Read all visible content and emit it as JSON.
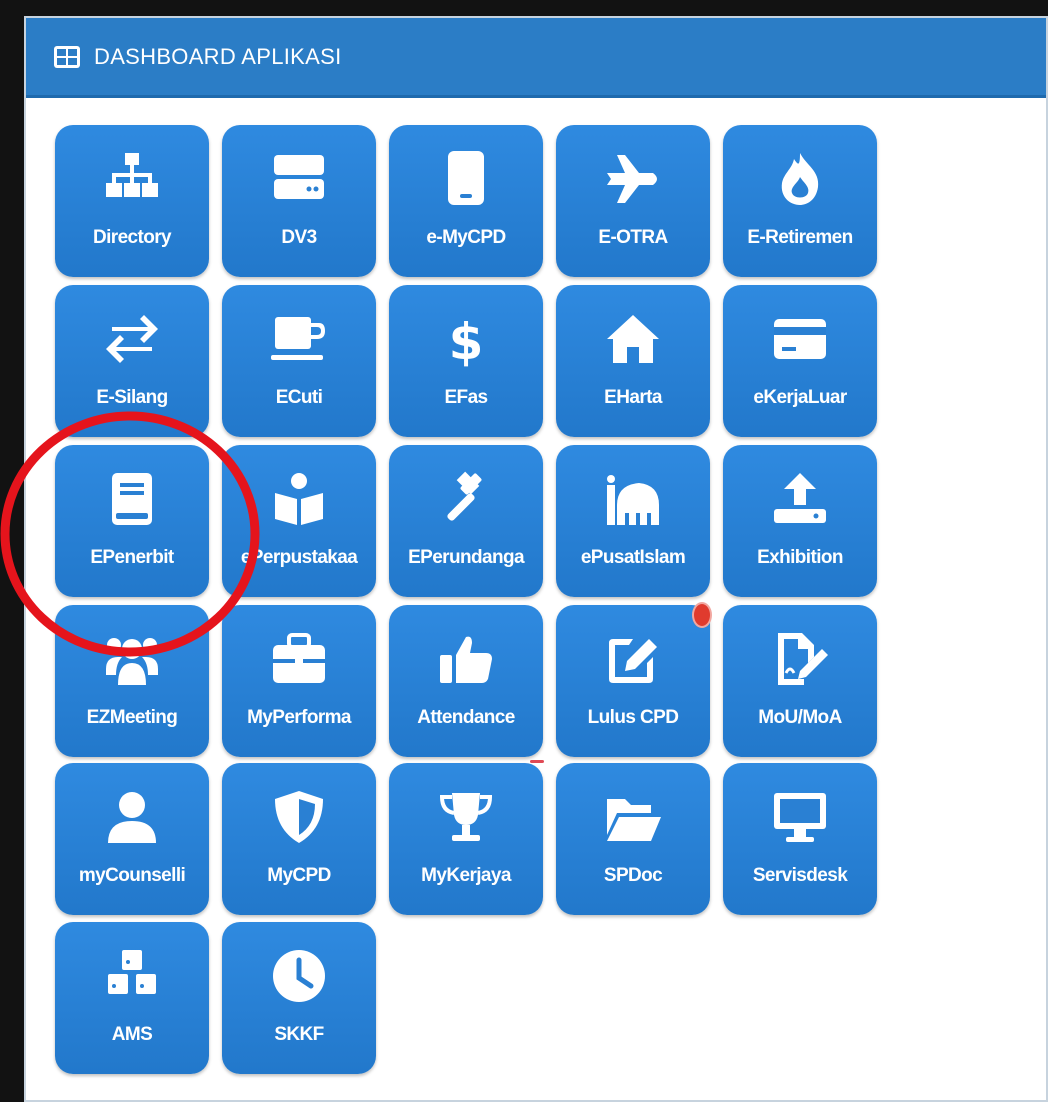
{
  "header": {
    "title": "DASHBOARD APLIKASI",
    "icon": "th-large-icon"
  },
  "colors": {
    "header_bg": "#2b7dc6",
    "tile_bg": "#2a84da",
    "highlight": "#e5141c",
    "notification": "#e03b2e"
  },
  "tiles": [
    {
      "label": "Directory",
      "icon": "sitemap-icon"
    },
    {
      "label": "DV3",
      "icon": "server-icon"
    },
    {
      "label": "e-MyCPD",
      "icon": "tablet-icon"
    },
    {
      "label": "E-OTRA",
      "icon": "plane-icon"
    },
    {
      "label": "E-Retiremen",
      "icon": "fire-icon"
    },
    {
      "label": "E-Silang",
      "icon": "exchange-icon"
    },
    {
      "label": "ECuti",
      "icon": "coffee-icon"
    },
    {
      "label": "EFas",
      "icon": "dollar-icon"
    },
    {
      "label": "EHarta",
      "icon": "home-icon"
    },
    {
      "label": "eKerjaLuar",
      "icon": "credit-card-icon"
    },
    {
      "label": "EPenerbit",
      "icon": "book-icon"
    },
    {
      "label": "ePerpustakaa",
      "icon": "book-reader-icon"
    },
    {
      "label": "EPerundanga",
      "icon": "gavel-icon"
    },
    {
      "label": "ePusatIslam",
      "icon": "mosque-icon"
    },
    {
      "label": "Exhibition",
      "icon": "upload-icon"
    },
    {
      "label": "EZMeeting",
      "icon": "users-icon"
    },
    {
      "label": "MyPerforma",
      "icon": "briefcase-icon"
    },
    {
      "label": "Attendance",
      "icon": "thumbs-up-icon"
    },
    {
      "label": "Lulus CPD",
      "icon": "edit-icon"
    },
    {
      "label": "MoU/MoA",
      "icon": "file-signature-icon"
    },
    {
      "label": "myCounselli",
      "icon": "user-icon"
    },
    {
      "label": "MyCPD",
      "icon": "shield-icon"
    },
    {
      "label": "MyKerjaya",
      "icon": "trophy-icon"
    },
    {
      "label": "SPDoc",
      "icon": "folder-open-icon"
    },
    {
      "label": "Servisdesk",
      "icon": "desktop-icon"
    },
    {
      "label": "AMS",
      "icon": "cubes-icon"
    },
    {
      "label": "SKKF",
      "icon": "clock-icon"
    }
  ],
  "annotations": {
    "highlighted_tile": "EPenerbit",
    "notification_on": "Lulus CPD"
  }
}
